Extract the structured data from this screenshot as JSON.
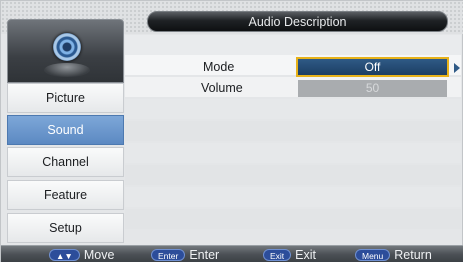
{
  "header": {
    "title": "Audio Description"
  },
  "sidebar": {
    "logo_icon": "speaker-icon",
    "items": [
      {
        "label": "Picture",
        "active": false
      },
      {
        "label": "Sound",
        "active": true
      },
      {
        "label": "Channel",
        "active": false
      },
      {
        "label": "Feature",
        "active": false
      },
      {
        "label": "Setup",
        "active": false
      }
    ]
  },
  "settings": {
    "mode": {
      "label": "Mode",
      "value": "Off"
    },
    "volume": {
      "label": "Volume",
      "value": "50"
    }
  },
  "footer": {
    "hints": [
      {
        "key": "▲▼",
        "label": "Move"
      },
      {
        "key": "Enter",
        "label": "Enter"
      },
      {
        "key": "Exit",
        "label": "Exit"
      },
      {
        "key": "Menu",
        "label": "Return"
      }
    ]
  },
  "colors": {
    "selection": "#1c3e63",
    "focus_border": "#e7b21a",
    "active_menu": "#6a96cc",
    "key_badge": "#2c4d9a"
  }
}
